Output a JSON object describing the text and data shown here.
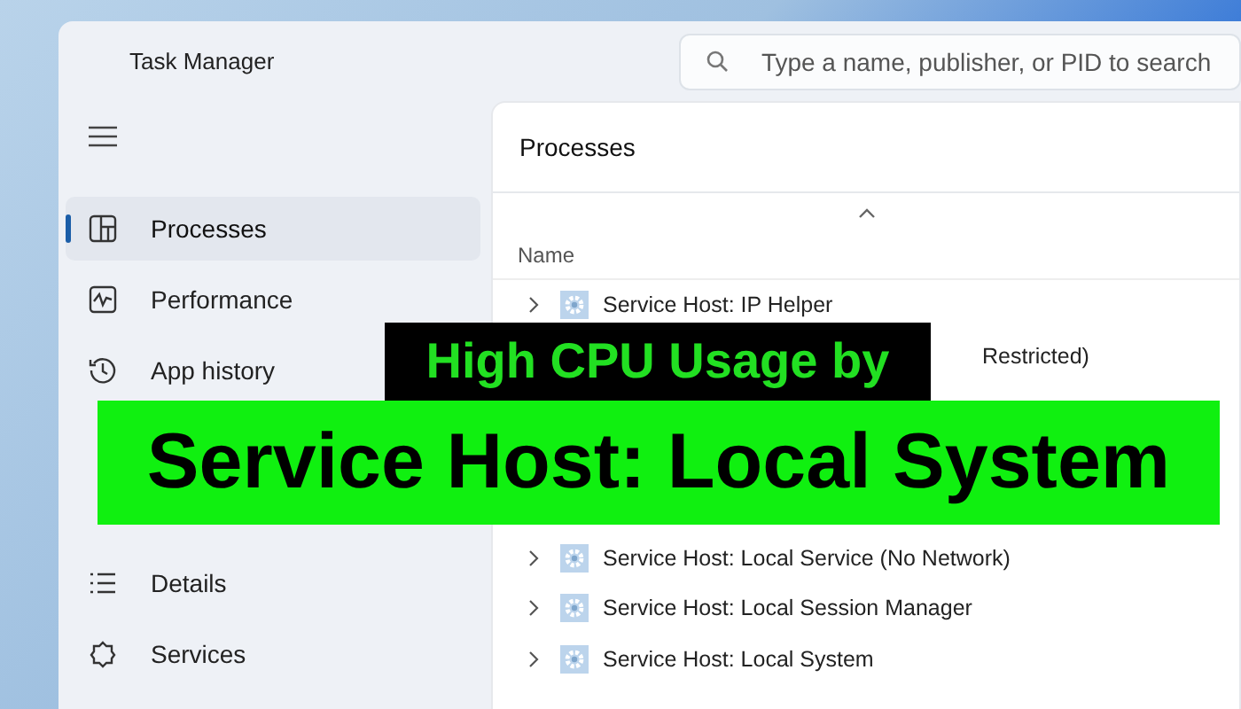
{
  "window": {
    "title": "Task Manager"
  },
  "search": {
    "placeholder": "Type a name, publisher, or PID to search"
  },
  "sidebar": {
    "items": [
      {
        "kind": "item",
        "label": "Processes",
        "selected": true
      },
      {
        "kind": "item",
        "label": "Performance",
        "selected": false
      },
      {
        "kind": "item",
        "label": "App history",
        "selected": false
      },
      {
        "kind": "covered"
      },
      {
        "kind": "covered"
      },
      {
        "kind": "item",
        "label": "Details",
        "selected": false
      },
      {
        "kind": "item",
        "label": "Services",
        "selected": false
      }
    ]
  },
  "panel": {
    "title": "Processes",
    "column": "Name",
    "rows": [
      {
        "kind": "full",
        "name": "Service Host: IP Helper"
      },
      {
        "kind": "partial",
        "name": "Restricted)"
      },
      {
        "kind": "covered"
      },
      {
        "kind": "covered"
      },
      {
        "kind": "covered"
      },
      {
        "kind": "full",
        "name": "Service Host: Local Service (No Network)"
      },
      {
        "kind": "full",
        "name": "Service Host: Local Session Manager"
      },
      {
        "kind": "full",
        "name": "Service Host: Local System"
      }
    ]
  },
  "banner": {
    "line_1": "High CPU Usage by",
    "line_2": "Service Host: Local System"
  }
}
